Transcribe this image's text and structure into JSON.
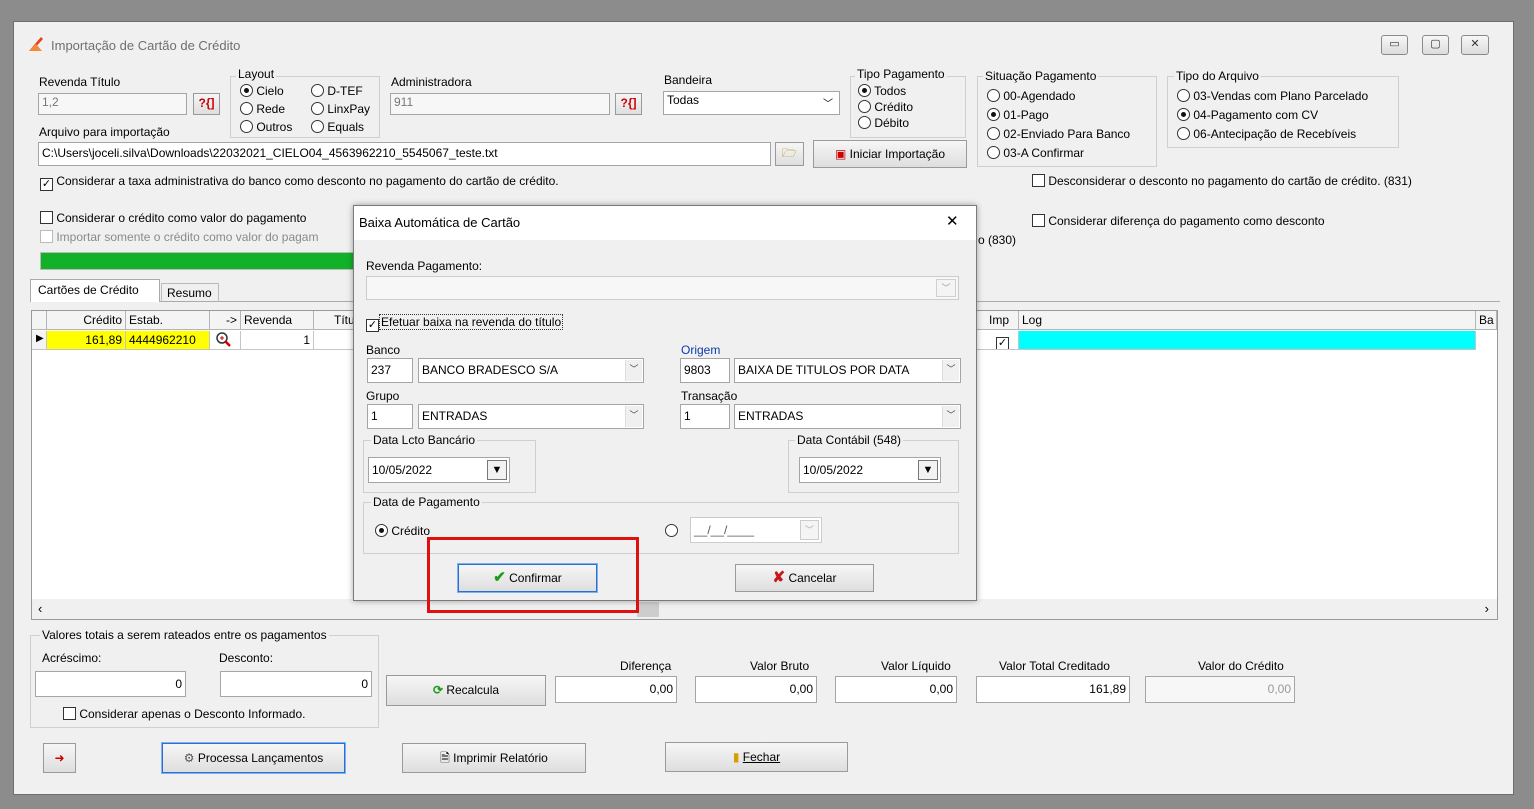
{
  "window": {
    "title": "Importação de Cartão de Crédito",
    "controls": [
      "minimize",
      "maximize",
      "close"
    ]
  },
  "top": {
    "revenda_titulo_label": "Revenda Título",
    "revenda_titulo_value": "1,2",
    "lookup_glyph": "?{]",
    "layout": {
      "title": "Layout",
      "options": [
        "Cielo",
        "Rede",
        "Outros",
        "D-TEF",
        "LinxPay",
        "Equals"
      ],
      "selected": "Cielo"
    },
    "administradora_label": "Administradora",
    "administradora_value": "911",
    "bandeira_label": "Bandeira",
    "bandeira_value": "Todas",
    "tipo_pagamento": {
      "title": "Tipo Pagamento",
      "options": [
        "Todos",
        "Crédito",
        "Débito"
      ],
      "selected": "Todos"
    },
    "situacao_pagamento": {
      "title": "Situação Pagamento",
      "options": [
        "00-Agendado",
        "01-Pago",
        "02-Enviado Para Banco",
        "03-A Confirmar"
      ],
      "selected": "01-Pago"
    },
    "tipo_arquivo": {
      "title": "Tipo do Arquivo",
      "options": [
        "03-Vendas com Plano Parcelado",
        "04-Pagamento com CV",
        "06-Antecipação de Recebíveis"
      ],
      "selected": "04-Pagamento com CV"
    },
    "arquivo_label": "Arquivo para importação",
    "arquivo_value": "C:\\Users\\joceli.silva\\Downloads\\22032021_CIELO04_4563962210_5545067_teste.txt",
    "iniciar_label": "Iniciar Importação",
    "chk_taxa": "Considerar a taxa administrativa do banco como desconto no pagamento do cartão de crédito.",
    "chk_desconsiderar": "Desconsiderar o desconto no pagamento do cartão de crédito. (831)",
    "chk_credito_valor": "Considerar o crédito como valor do pagamento",
    "chk_importar_credito": "Importar somente o crédito como valor do pagam",
    "chk_diferenca": "Considerar diferença do pagamento como desconto",
    "partial_830": "o (830)",
    "progress": 1.0
  },
  "tabs": [
    "Cartões de Crédito",
    "Resumo"
  ],
  "grid": {
    "headers": [
      "Crédito",
      "Estab.",
      "->",
      "Revenda",
      "Títu",
      "Imp",
      "Log",
      "Ba"
    ],
    "row": {
      "credito": "161,89",
      "estab": "4444962210",
      "revenda": "1",
      "imp_checked": true
    }
  },
  "dialog": {
    "title": "Baixa Automática de Cartão",
    "revenda_pagamento_label": "Revenda Pagamento:",
    "revenda_pagamento_value": "",
    "efetuar_label": "Efetuar baixa na revenda do título",
    "banco_label": "Banco",
    "banco_code": "237",
    "banco_name": "BANCO BRADESCO S/A",
    "origem_label": "Origem",
    "origem_code": "9803",
    "origem_name": "BAIXA DE TITULOS POR DATA",
    "grupo_label": "Grupo",
    "grupo_code": "1",
    "grupo_name": "ENTRADAS",
    "transacao_label": "Transação",
    "transacao_code": "1",
    "transacao_name": "ENTRADAS",
    "data_lcto_label": "Data Lcto Bancário",
    "data_lcto_value": "10/05/2022",
    "data_contabil_label": "Data Contábil (548)",
    "data_contabil_value": "10/05/2022",
    "data_pagamento_label": "Data de Pagamento",
    "credito_option": "Crédito",
    "date_mask": "__/__/____",
    "confirmar_label": "Confirmar",
    "cancelar_label": "Cancelar",
    "close_glyph": "✕"
  },
  "totals": {
    "group_title": "Valores totais a serem rateados entre os pagamentos",
    "acrescimo_label": "Acréscimo:",
    "acrescimo_value": "0",
    "desconto_label": "Desconto:",
    "desconto_value": "0",
    "recalcula_label": "Recalcula",
    "chk_desconto_informado": "Considerar apenas o Desconto Informado.",
    "diferenca_label": "Diferença",
    "diferenca_value": "0,00",
    "valor_bruto_label": "Valor Bruto",
    "valor_bruto_value": "0,00",
    "valor_liquido_label": "Valor Líquido",
    "valor_liquido_value": "0,00",
    "valor_total_label": "Valor Total Creditado",
    "valor_total_value": "161,89",
    "valor_credito_label": "Valor do Crédito",
    "valor_credito_value": "0,00"
  },
  "footer": {
    "processa_label": "Processa Lançamentos",
    "imprimir_label": "Imprimir Relatório",
    "fechar_label": "Fechar"
  },
  "colors": {
    "highlight_row": "#ffff00",
    "log_cell": "#00ffff",
    "progress": "#11b22a",
    "annotation": "#e01010"
  }
}
